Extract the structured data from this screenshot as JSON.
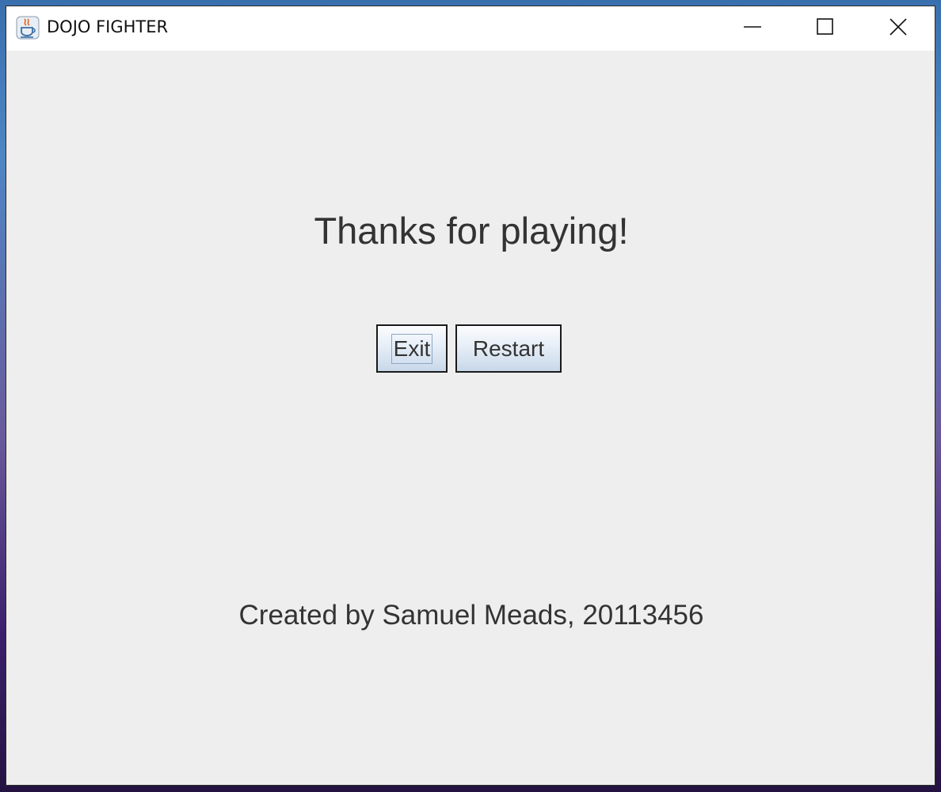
{
  "window": {
    "title": "DOJO FIGHTER",
    "app_icon": "java-cup-icon",
    "controls": {
      "minimize_icon": "minimize-icon",
      "maximize_icon": "maximize-icon",
      "close_icon": "close-icon"
    }
  },
  "main": {
    "heading": "Thanks for playing!",
    "buttons": {
      "exit_label": "Exit",
      "restart_label": "Restart"
    },
    "credits": "Created by Samuel Meads, 20113456"
  },
  "colors": {
    "panel_background": "#eeeeee",
    "text": "#333333",
    "button_gradient_top": "#fbfcfe",
    "button_gradient_bottom": "#c8d8ea"
  }
}
